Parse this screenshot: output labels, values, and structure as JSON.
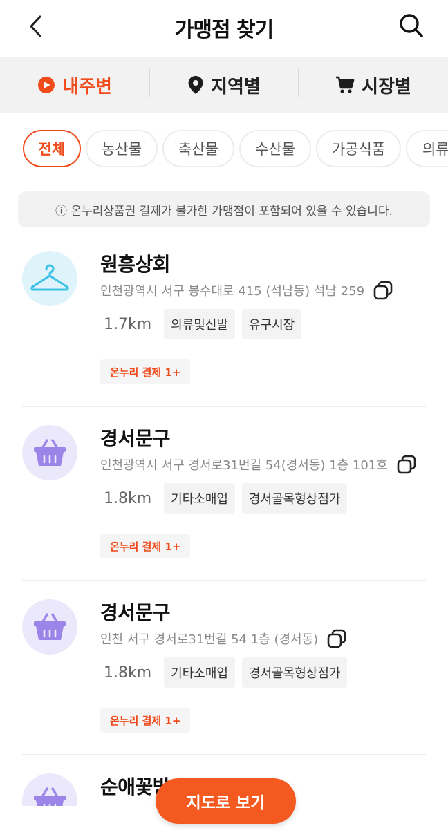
{
  "header": {
    "title": "가맹점 찾기",
    "back_icon": "chevron-left-icon",
    "search_icon": "search-icon"
  },
  "segments": [
    {
      "label": "내주변",
      "icon": "play-circle-icon",
      "active": true
    },
    {
      "label": "지역별",
      "icon": "map-pin-icon",
      "active": false
    },
    {
      "label": "시장별",
      "icon": "shopping-cart-icon",
      "active": false
    }
  ],
  "chips": [
    "전체",
    "농산물",
    "축산물",
    "수산물",
    "가공식품",
    "의류"
  ],
  "notice": "ⓘ 온누리상품권 결제가 불가한 가맹점이 포함되어 있을 수 있습니다.",
  "stores": [
    {
      "name": "원흥상회",
      "address": "인천광역시 서구 봉수대로 415 (석남동) 석남 259",
      "distance": "1.7km",
      "tags": [
        "의류및신발",
        "유구시장"
      ],
      "payment": "온누리 결제 1+",
      "icon": "hanger-icon"
    },
    {
      "name": "경서문구",
      "address": "인천광역시 서구 경서로31번길 54(경서동) 1층 101호",
      "distance": "1.8km",
      "tags": [
        "기타소매업",
        "경서골목형상점가"
      ],
      "payment": "온누리 결제 1+",
      "icon": "basket-icon"
    },
    {
      "name": "경서문구",
      "address": "인천 서구 경서로31번길 54 1층 (경서동)",
      "distance": "1.8km",
      "tags": [
        "기타소매업",
        "경서골목형상점가"
      ],
      "payment": "온누리 결제 1+",
      "icon": "basket-icon"
    },
    {
      "name": "순애꽃방",
      "icon": "basket-icon"
    }
  ],
  "map_button": "지도로 보기",
  "colors": {
    "accent": "#f04b1b",
    "map_button": "#f45a1f",
    "hanger_bg": "#dff3fb",
    "hanger_stroke": "#3cc1e6",
    "basket_bg": "#ece8fb",
    "basket_fill": "#9b85e8"
  }
}
